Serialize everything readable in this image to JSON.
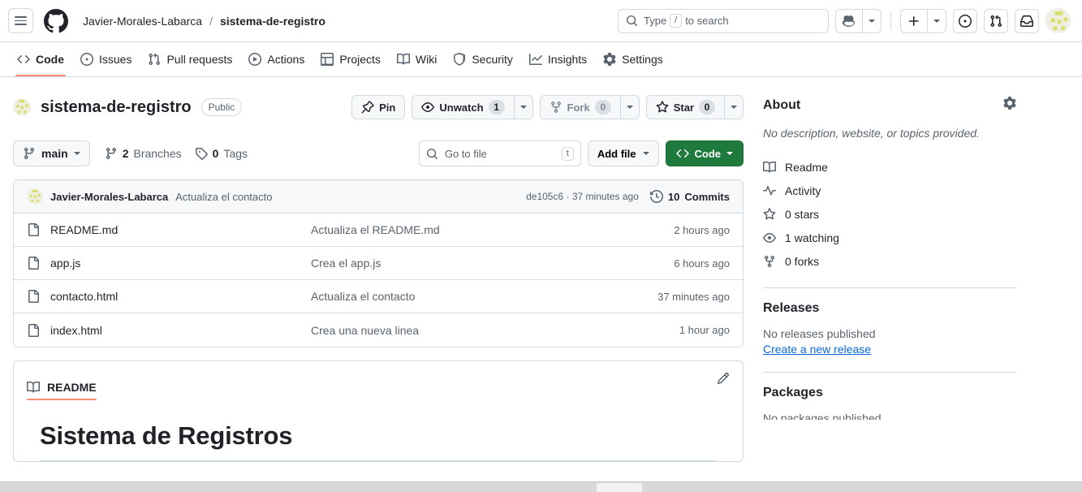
{
  "header": {
    "menu_icon": "hamburger-icon",
    "logo_icon": "github-logo-icon",
    "owner": "Javier-Morales-Labarca",
    "separator": "/",
    "repo": "sistema-de-registro",
    "search": {
      "placeholder_before": "Type",
      "kbd": "/",
      "placeholder_after": "to search",
      "icon": "search-icon"
    },
    "copilot_label": "copilot-icon",
    "create_new_label": "plus-icon",
    "issues_icon": "issue-opened-icon",
    "pull_requests_icon": "git-pull-request-icon",
    "inbox_icon": "inbox-icon",
    "avatar_label": "user-avatar"
  },
  "repo_nav": {
    "tabs": [
      {
        "label": "Code",
        "icon": "code-icon",
        "active": true
      },
      {
        "label": "Issues",
        "icon": "issue-opened-icon",
        "active": false
      },
      {
        "label": "Pull requests",
        "icon": "git-pull-request-icon",
        "active": false
      },
      {
        "label": "Actions",
        "icon": "play-icon",
        "active": false
      },
      {
        "label": "Projects",
        "icon": "table-icon",
        "active": false
      },
      {
        "label": "Wiki",
        "icon": "book-icon",
        "active": false
      },
      {
        "label": "Security",
        "icon": "shield-icon",
        "active": false
      },
      {
        "label": "Insights",
        "icon": "graph-icon",
        "active": false
      },
      {
        "label": "Settings",
        "icon": "gear-icon",
        "active": false
      }
    ]
  },
  "repo_header": {
    "name": "sistema-de-registro",
    "visibility": "Public",
    "actions": {
      "pin": "Pin",
      "watch": "Unwatch",
      "watch_count": "1",
      "fork": "Fork",
      "fork_count": "0",
      "star": "Star",
      "star_count": "0"
    }
  },
  "toolbar": {
    "branch": "main",
    "branches_count": "2",
    "branches_label": "Branches",
    "tags_count": "0",
    "tags_label": "Tags",
    "go_to_file_placeholder": "Go to file",
    "go_to_file_kbd": "t",
    "add_file": "Add file",
    "code": "Code"
  },
  "latest_commit": {
    "author": "Javier-Morales-Labarca",
    "message": "Actualiza el contacto",
    "sha": "de105c6",
    "sha_separator": "·",
    "time": "37 minutes ago",
    "commits_count": "10",
    "commits_label": "Commits"
  },
  "files": [
    {
      "name": "README.md",
      "icon": "file-icon",
      "message": "Actualiza el README.md",
      "time": "2 hours ago"
    },
    {
      "name": "app.js",
      "icon": "file-icon",
      "message": "Crea el app.js",
      "time": "6 hours ago"
    },
    {
      "name": "contacto.html",
      "icon": "file-icon",
      "message": "Actualiza el contacto",
      "time": "37 minutes ago"
    },
    {
      "name": "index.html",
      "icon": "file-icon",
      "message": "Crea una nueva linea",
      "time": "1 hour ago"
    }
  ],
  "readme": {
    "tab_label": "README",
    "tab_icon": "book-icon",
    "edit_icon": "pencil-icon",
    "heading": "Sistema de Registros"
  },
  "sidebar": {
    "about_title": "About",
    "settings_icon": "gear-icon",
    "description": "No description, website, or topics provided.",
    "links": [
      {
        "label": "Readme",
        "icon": "book-icon"
      },
      {
        "label": "Activity",
        "icon": "pulse-icon"
      },
      {
        "label": "0 stars",
        "icon": "star-icon"
      },
      {
        "label": "1 watching",
        "icon": "eye-icon"
      },
      {
        "label": "0 forks",
        "icon": "fork-icon"
      }
    ],
    "releases_title": "Releases",
    "releases_note": "No releases published",
    "releases_link": "Create a new release",
    "packages_title": "Packages",
    "packages_note": "No packages published"
  },
  "colors": {
    "accent_green": "#1f7a3d",
    "link_blue": "#0969da",
    "tab_underline": "#fd8c73",
    "border": "#d1d9e0",
    "muted_text": "#59636e"
  }
}
